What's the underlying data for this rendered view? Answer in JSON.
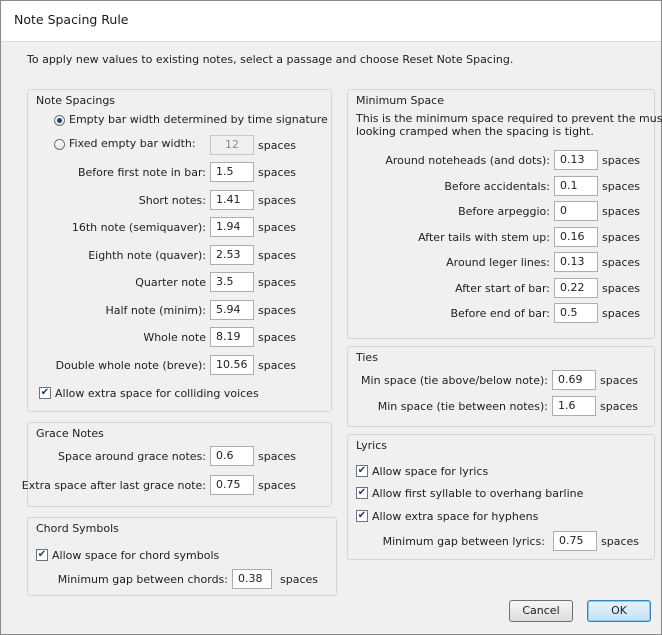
{
  "window": {
    "title": "Note Spacing Rule"
  },
  "intro": "To apply new values to existing notes, select a passage and choose Reset Note Spacing.",
  "note_spacings": {
    "title": "Note Spacings",
    "radio_empty_bar": "Empty bar width determined by time signature",
    "radio_fixed": "Fixed empty bar width:",
    "fixed_value": "12",
    "unit": "spaces",
    "rows": [
      {
        "label": "Before first note in bar:",
        "value": "1.5"
      },
      {
        "label": "Short notes:",
        "value": "1.41"
      },
      {
        "label": "16th note (semiquaver):",
        "value": "1.94"
      },
      {
        "label": "Eighth note (quaver):",
        "value": "2.53"
      },
      {
        "label": "Quarter note",
        "value": "3.5"
      },
      {
        "label": "Half note (minim):",
        "value": "5.94"
      },
      {
        "label": "Whole note",
        "value": "8.19"
      },
      {
        "label": "Double whole note (breve):",
        "value": "10.56"
      }
    ],
    "check_colliding": "Allow extra space for colliding voices"
  },
  "grace_notes": {
    "title": "Grace Notes",
    "rows": [
      {
        "label": "Space around grace notes:",
        "value": "0.6"
      },
      {
        "label": "Extra space after last grace note:",
        "value": "0.75"
      }
    ],
    "unit": "spaces"
  },
  "chord_symbols": {
    "title": "Chord Symbols",
    "check_allow": "Allow space for chord symbols",
    "gap_label": "Minimum gap between chords:",
    "gap_value": "0.38",
    "unit": "spaces"
  },
  "minimum_space": {
    "title": "Minimum Space",
    "desc1": "This is the minimum space required to prevent the music",
    "desc2": "looking cramped when the spacing is tight.",
    "unit": "spaces",
    "rows": [
      {
        "label": "Around noteheads (and dots):",
        "value": "0.13"
      },
      {
        "label": "Before accidentals:",
        "value": "0.1"
      },
      {
        "label": "Before arpeggio:",
        "value": "0"
      },
      {
        "label": "After tails with stem up:",
        "value": "0.16"
      },
      {
        "label": "Around leger lines:",
        "value": "0.13"
      },
      {
        "label": "After start of bar:",
        "value": "0.22"
      },
      {
        "label": "Before end of bar:",
        "value": "0.5"
      }
    ]
  },
  "ties": {
    "title": "Ties",
    "unit": "spaces",
    "rows": [
      {
        "label": "Min space (tie above/below note):",
        "value": "0.69"
      },
      {
        "label": "Min space (tie between notes):",
        "value": "1.6"
      }
    ]
  },
  "lyrics": {
    "title": "Lyrics",
    "check_space": "Allow space for lyrics",
    "check_overhang": "Allow first syllable to overhang barline",
    "check_hyphens": "Allow extra space for hyphens",
    "gap_label": "Minimum gap between lyrics:",
    "gap_value": "0.75",
    "unit": "spaces"
  },
  "buttons": {
    "cancel": "Cancel",
    "ok": "OK"
  },
  "checkmark_glyph": "✔"
}
